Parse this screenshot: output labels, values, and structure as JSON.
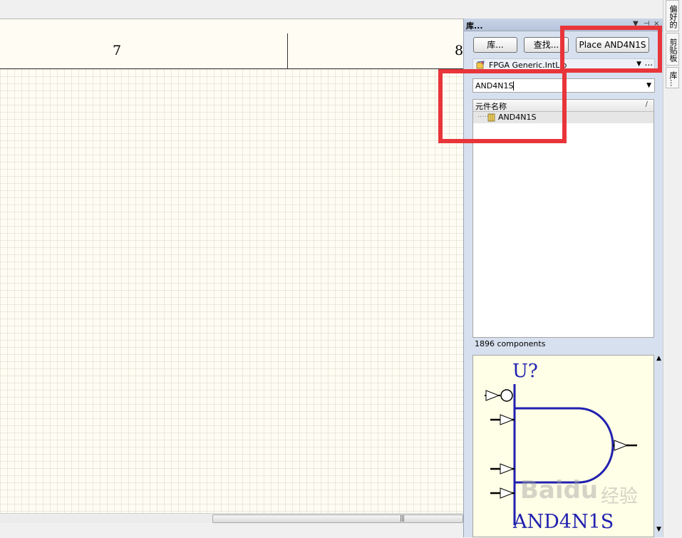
{
  "schematic": {
    "zone_left": "7",
    "zone_right": "8"
  },
  "panel": {
    "title": "库...",
    "pin_icon": "pin-icon",
    "close_label": "×",
    "buttons": {
      "libraries": "库...",
      "search": "查找...",
      "place": "Place AND4N1S"
    },
    "library_name": "FPGA Generic.IntLib",
    "library_more": "...",
    "filter_value": "AND4N1S",
    "list_header": "元件名称",
    "list_sort": "/",
    "components": [
      {
        "name": "AND4N1S"
      }
    ],
    "component_count": "1896 components"
  },
  "preview": {
    "designator": "U?",
    "part_name": "AND4N1S",
    "colors": {
      "symbol": "#2020b0",
      "pin": "#000000",
      "background": "#fffee6"
    }
  },
  "dock_tabs": [
    {
      "label": "偏好的"
    },
    {
      "label": "剪贴板"
    },
    {
      "label": "库..."
    }
  ],
  "watermark": {
    "brand": "Baidu",
    "suffix": "经验"
  },
  "highlight_color": "#e8353a"
}
